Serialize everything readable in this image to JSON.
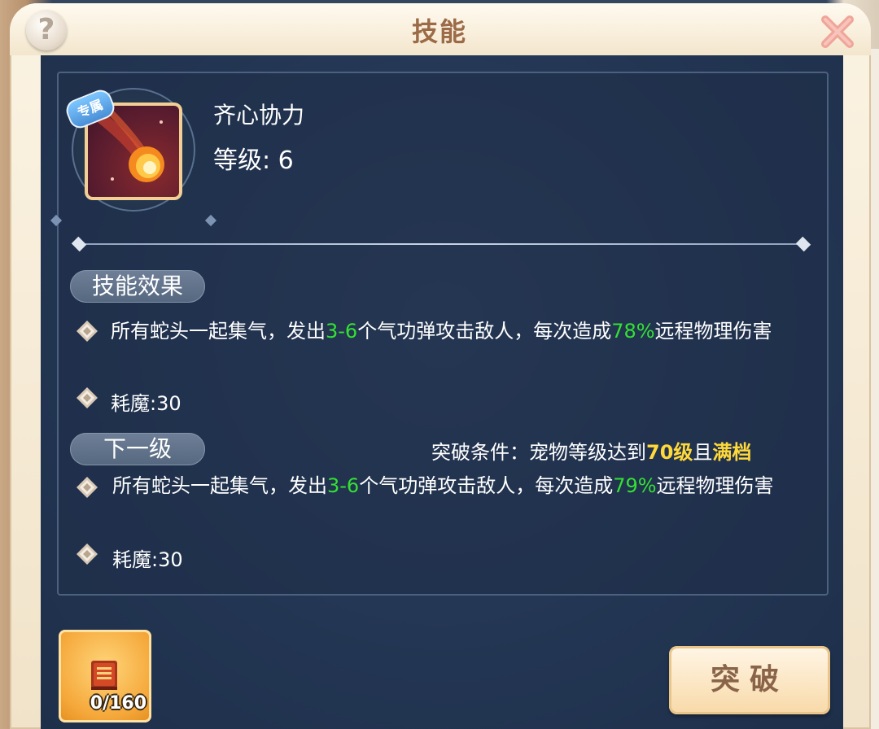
{
  "dialog": {
    "title": "技能",
    "help_label": "?",
    "close_icon": "close-x-icon"
  },
  "skill": {
    "tag": "专属",
    "name": "齐心协力",
    "level_label": "等级: 6",
    "icon": "fireball-icon"
  },
  "current": {
    "section_label": "技能效果",
    "desc_parts": [
      "所有蛇头一起集气，发出",
      "3-6",
      "个气功弹攻击敌人，每次造成",
      "78%",
      "远程物理伤害"
    ],
    "cost": "耗魔:30"
  },
  "next": {
    "section_label": "下一级",
    "condition_parts": [
      "突破条件：宠物等级达到",
      "70级",
      "且",
      "满档"
    ],
    "desc_parts": [
      "所有蛇头一起集气，发出",
      "3-6",
      "个气功弹攻击敌人，每次造成",
      "79%",
      "远程物理伤害"
    ],
    "cost": "耗魔:30"
  },
  "material": {
    "icon": "skill-book-icon",
    "count": "0/160"
  },
  "actions": {
    "breakthrough_label": "突破"
  },
  "colors": {
    "highlight_green": "#33e133",
    "highlight_yellow": "#ffd83a",
    "title_brown": "#9b6a47",
    "panel_navy": "#223552"
  }
}
